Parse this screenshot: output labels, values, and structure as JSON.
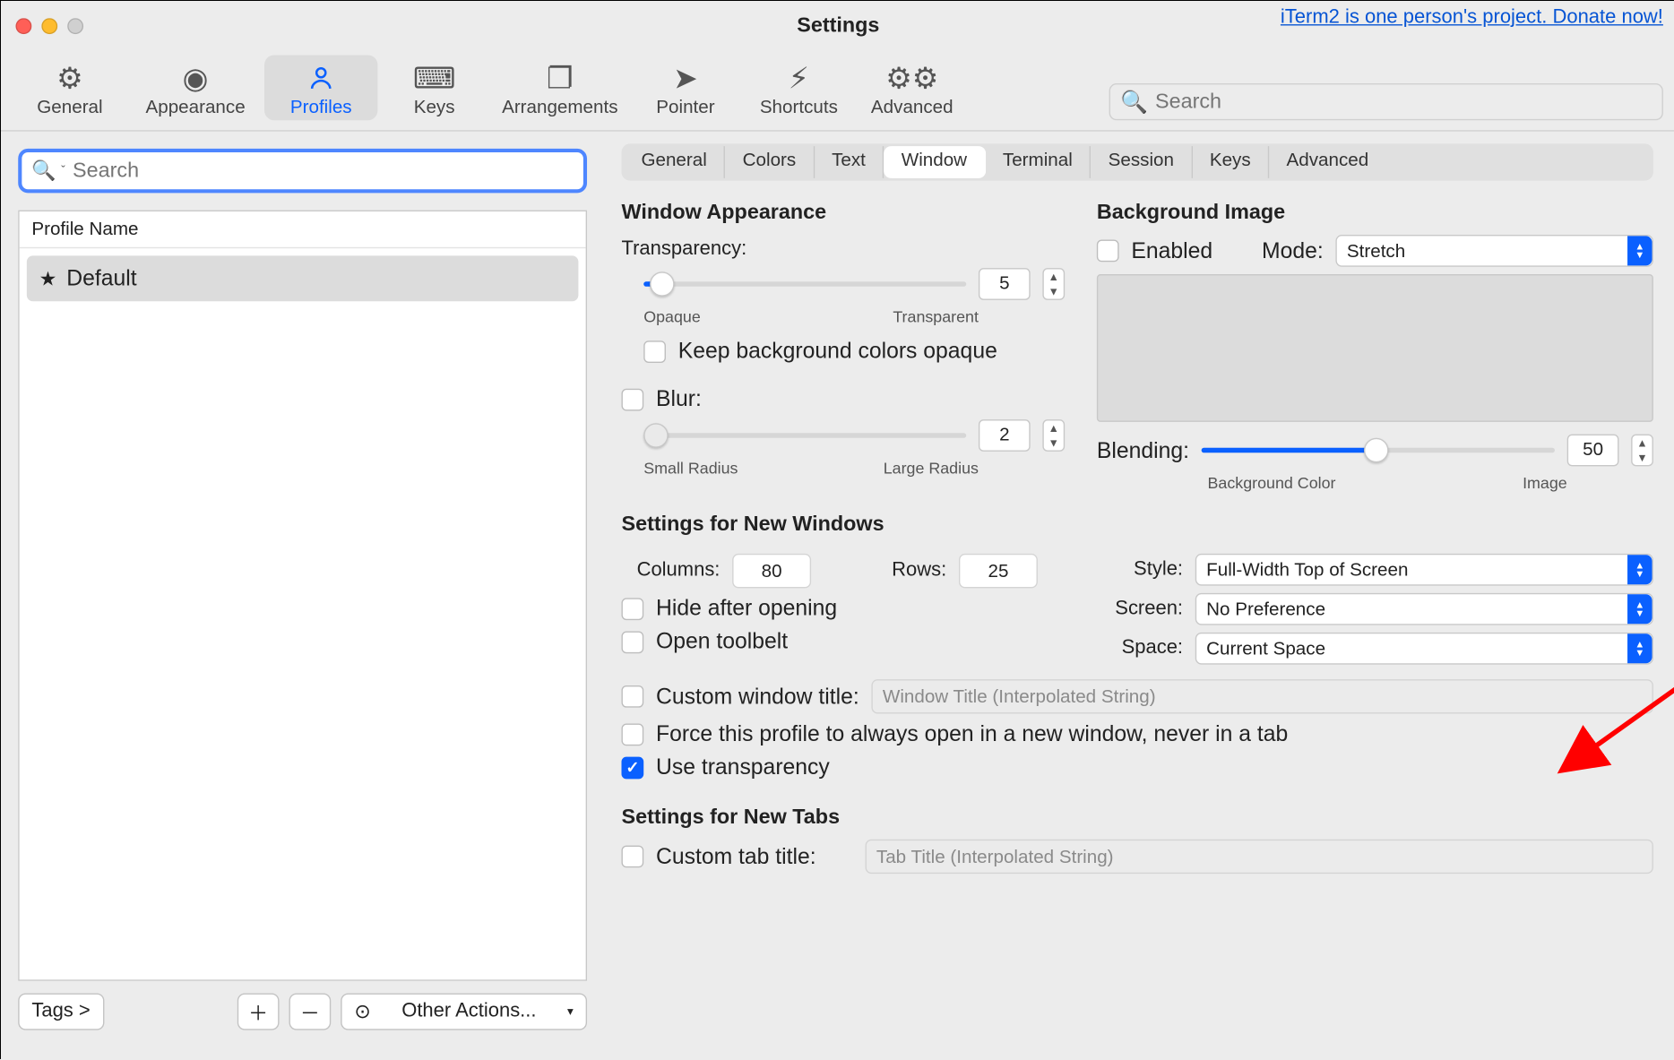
{
  "window": {
    "title": "Settings"
  },
  "donate_link": "iTerm2 is one person's project. Donate now!",
  "toolbar": {
    "items": [
      {
        "label": "General"
      },
      {
        "label": "Appearance"
      },
      {
        "label": "Profiles"
      },
      {
        "label": "Keys"
      },
      {
        "label": "Arrangements"
      },
      {
        "label": "Pointer"
      },
      {
        "label": "Shortcuts"
      },
      {
        "label": "Advanced"
      }
    ],
    "search_placeholder": "Search"
  },
  "sidebar": {
    "search_placeholder": "Search",
    "header": "Profile Name",
    "profiles": [
      {
        "name": "Default",
        "starred": true
      }
    ],
    "tags_label": "Tags >",
    "other_actions_label": "Other Actions..."
  },
  "profile_tabs": [
    "General",
    "Colors",
    "Text",
    "Window",
    "Terminal",
    "Session",
    "Keys",
    "Advanced"
  ],
  "profile_tab_selected": "Window",
  "sections": {
    "window_appearance": "Window Appearance",
    "background_image": "Background Image",
    "settings_new_windows": "Settings for New Windows",
    "settings_new_tabs": "Settings for New Tabs"
  },
  "transparency": {
    "label": "Transparency:",
    "value": "5",
    "left_cap": "Opaque",
    "right_cap": "Transparent",
    "keep_opaque_label": "Keep background colors opaque"
  },
  "blur": {
    "label": "Blur:",
    "value": "2",
    "left_cap": "Small Radius",
    "right_cap": "Large Radius"
  },
  "bg_image": {
    "enabled_label": "Enabled",
    "mode_label": "Mode:",
    "mode_value": "Stretch",
    "blending_label": "Blending:",
    "blending_value": "50",
    "blending_left": "Background Color",
    "blending_right": "Image"
  },
  "new_windows": {
    "columns_label": "Columns:",
    "columns_value": "80",
    "rows_label": "Rows:",
    "rows_value": "25",
    "hide_label": "Hide after opening",
    "toolbelt_label": "Open toolbelt",
    "custom_title_label": "Custom window title:",
    "custom_title_placeholder": "Window Title (Interpolated String)",
    "force_label": "Force this profile to always open in a new window, never in a tab",
    "use_transparency_label": "Use transparency",
    "style_label": "Style:",
    "style_value": "Full-Width Top of Screen",
    "screen_label": "Screen:",
    "screen_value": "No Preference",
    "space_label": "Space:",
    "space_value": "Current Space"
  },
  "new_tabs": {
    "custom_tab_label": "Custom tab title:",
    "custom_tab_placeholder": "Tab Title (Interpolated String)"
  }
}
